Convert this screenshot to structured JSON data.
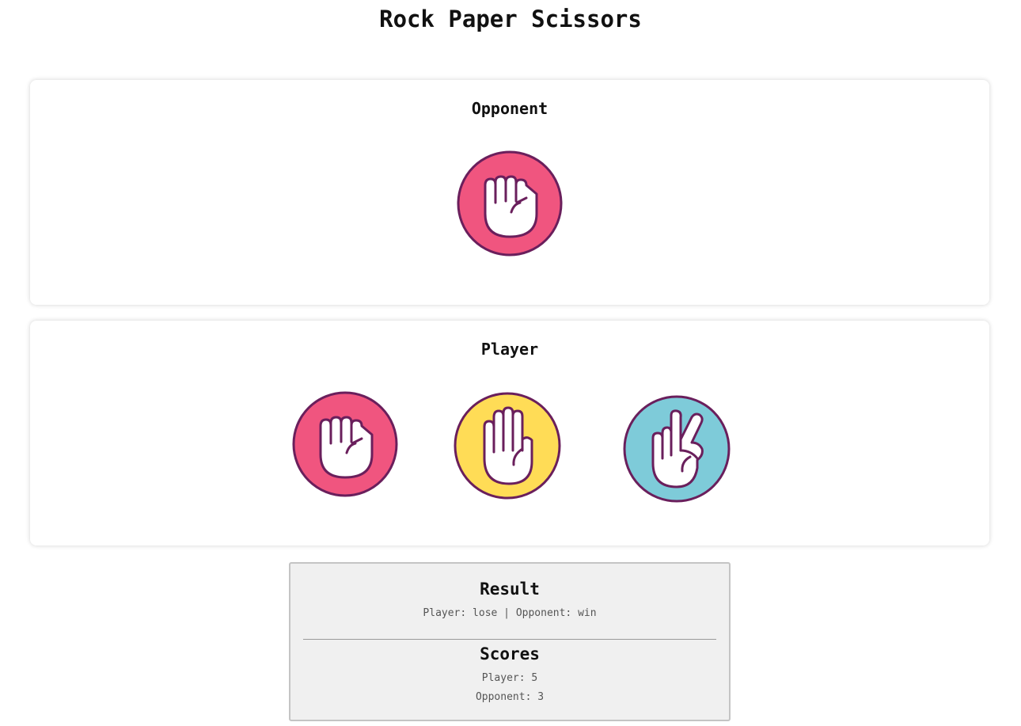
{
  "page": {
    "title": "Rock Paper Scissors"
  },
  "opponent": {
    "heading": "Opponent",
    "choice": {
      "name": "rock",
      "icon": "fist-icon",
      "color": "#f0557f"
    }
  },
  "player": {
    "heading": "Player",
    "choices": [
      {
        "name": "rock",
        "icon": "fist-icon",
        "color": "#f0557f"
      },
      {
        "name": "paper",
        "icon": "open-hand-icon",
        "color": "#ffdc56"
      },
      {
        "name": "scissors",
        "icon": "peace-hand-icon",
        "color": "#7ecbd9"
      }
    ]
  },
  "result": {
    "heading": "Result",
    "text": "Player: lose | Opponent: win"
  },
  "scores": {
    "heading": "Scores",
    "player": "Player: 5",
    "opponent": "Opponent: 3"
  },
  "colors": {
    "outline": "#6a1f5c",
    "rock": "#f0557f",
    "paper": "#ffdc56",
    "scissors": "#7ecbd9"
  }
}
